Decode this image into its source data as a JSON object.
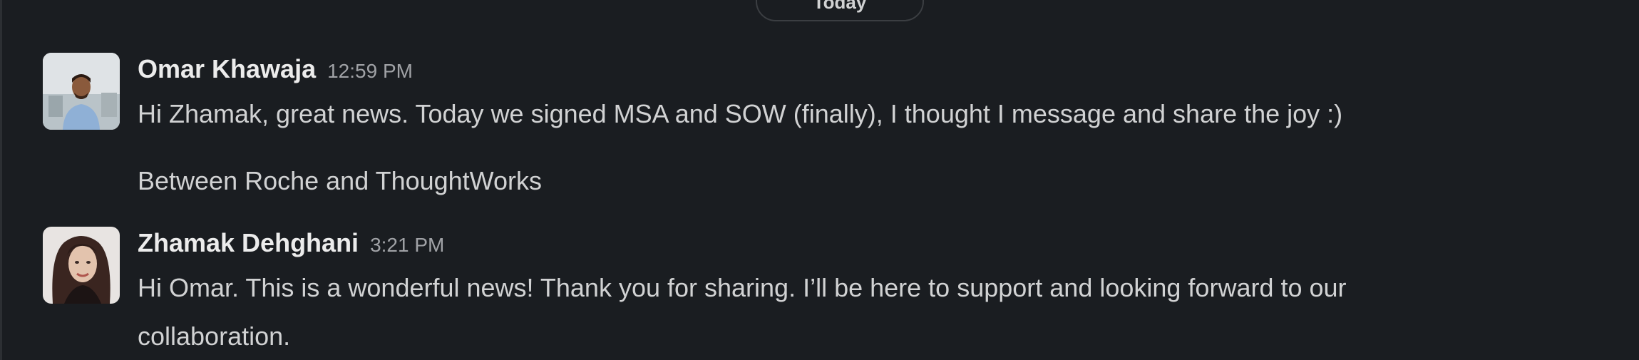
{
  "divider": {
    "label": "Today"
  },
  "messages": [
    {
      "sender": "Omar Khawaja",
      "time": "12:59 PM",
      "lines": [
        "Hi Zhamak, great news. Today we signed MSA and SOW (finally), I thought I message and share the joy :)",
        "Between Roche and ThoughtWorks"
      ]
    },
    {
      "sender": "Zhamak Dehghani",
      "time": "3:21 PM",
      "lines": [
        "Hi Omar. This is a wonderful news! Thank you for sharing. I’ll be here to support and looking forward to our",
        "collaboration."
      ]
    }
  ]
}
